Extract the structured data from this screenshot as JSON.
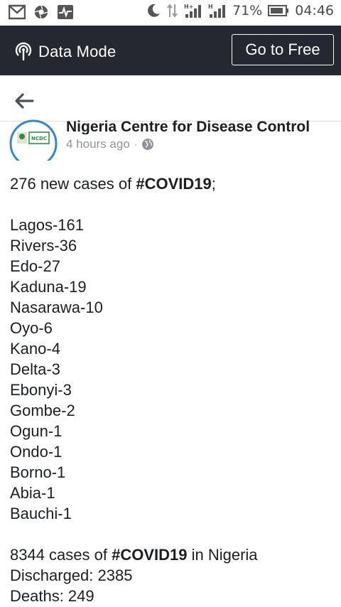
{
  "status_bar": {
    "battery_percent": "71%",
    "time": "04:46",
    "icons": [
      "gmail-icon",
      "shutter-icon",
      "pulse-icon",
      "moon-icon",
      "data-transfer-icon",
      "signal-h-plus-icon",
      "signal-h-icon",
      "battery-icon"
    ]
  },
  "data_mode_bar": {
    "label": "Data Mode",
    "go_free_label": "Go to Free",
    "background": "#252830"
  },
  "post": {
    "page_name": "Nigeria Centre for Disease Control",
    "time_ago": "4 hours ago",
    "separator": "·",
    "avatar_text": "NCDC",
    "intro_prefix": "276 new cases of ",
    "intro_hashtag": "#COVID19",
    "intro_suffix": ";",
    "cases": [
      "Lagos-161",
      "Rivers-36",
      "Edo-27",
      "Kaduna-19",
      "Nasarawa-10",
      "Oyo-6",
      "Kano-4",
      "Delta-3",
      "Ebonyi-3",
      "Gombe-2",
      "Ogun-1",
      "Ondo-1",
      "Borno-1",
      "Abia-1",
      "Bauchi-1"
    ],
    "total_prefix": "8344 cases of ",
    "total_hashtag": "#COVID19",
    "total_suffix": " in Nigeria",
    "discharged": "Discharged: 2385",
    "deaths": "Deaths: 249"
  }
}
